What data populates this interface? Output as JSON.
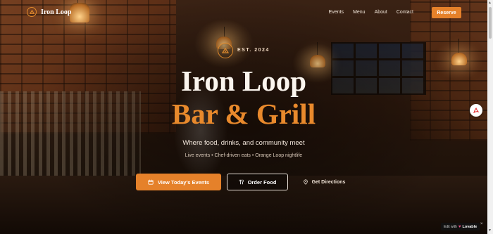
{
  "brand": {
    "name": "Iron Loop",
    "logo_icon": "loop-icon"
  },
  "nav": {
    "items": [
      {
        "label": "Events"
      },
      {
        "label": "Menu"
      },
      {
        "label": "About"
      },
      {
        "label": "Contact"
      }
    ],
    "cta_label": "Reserve"
  },
  "hero": {
    "est_label": "EST. 2024",
    "title_line1": "Iron Loop",
    "title_line2": "Bar & Grill",
    "tagline": "Where food, drinks, and community meet",
    "subline": "Live events • Chef-driven eats • Orange Loop nightlife",
    "buttons": {
      "events_label": "View Today's Events",
      "order_label": "Order Food",
      "directions_label": "Get Directions"
    }
  },
  "badge": {
    "edit_label": "Edit with",
    "brand_label": "Lovable",
    "close_label": "×"
  },
  "colors": {
    "accent": "#e5812a",
    "title": "#fbf5ee",
    "background": "#1a0f08"
  }
}
